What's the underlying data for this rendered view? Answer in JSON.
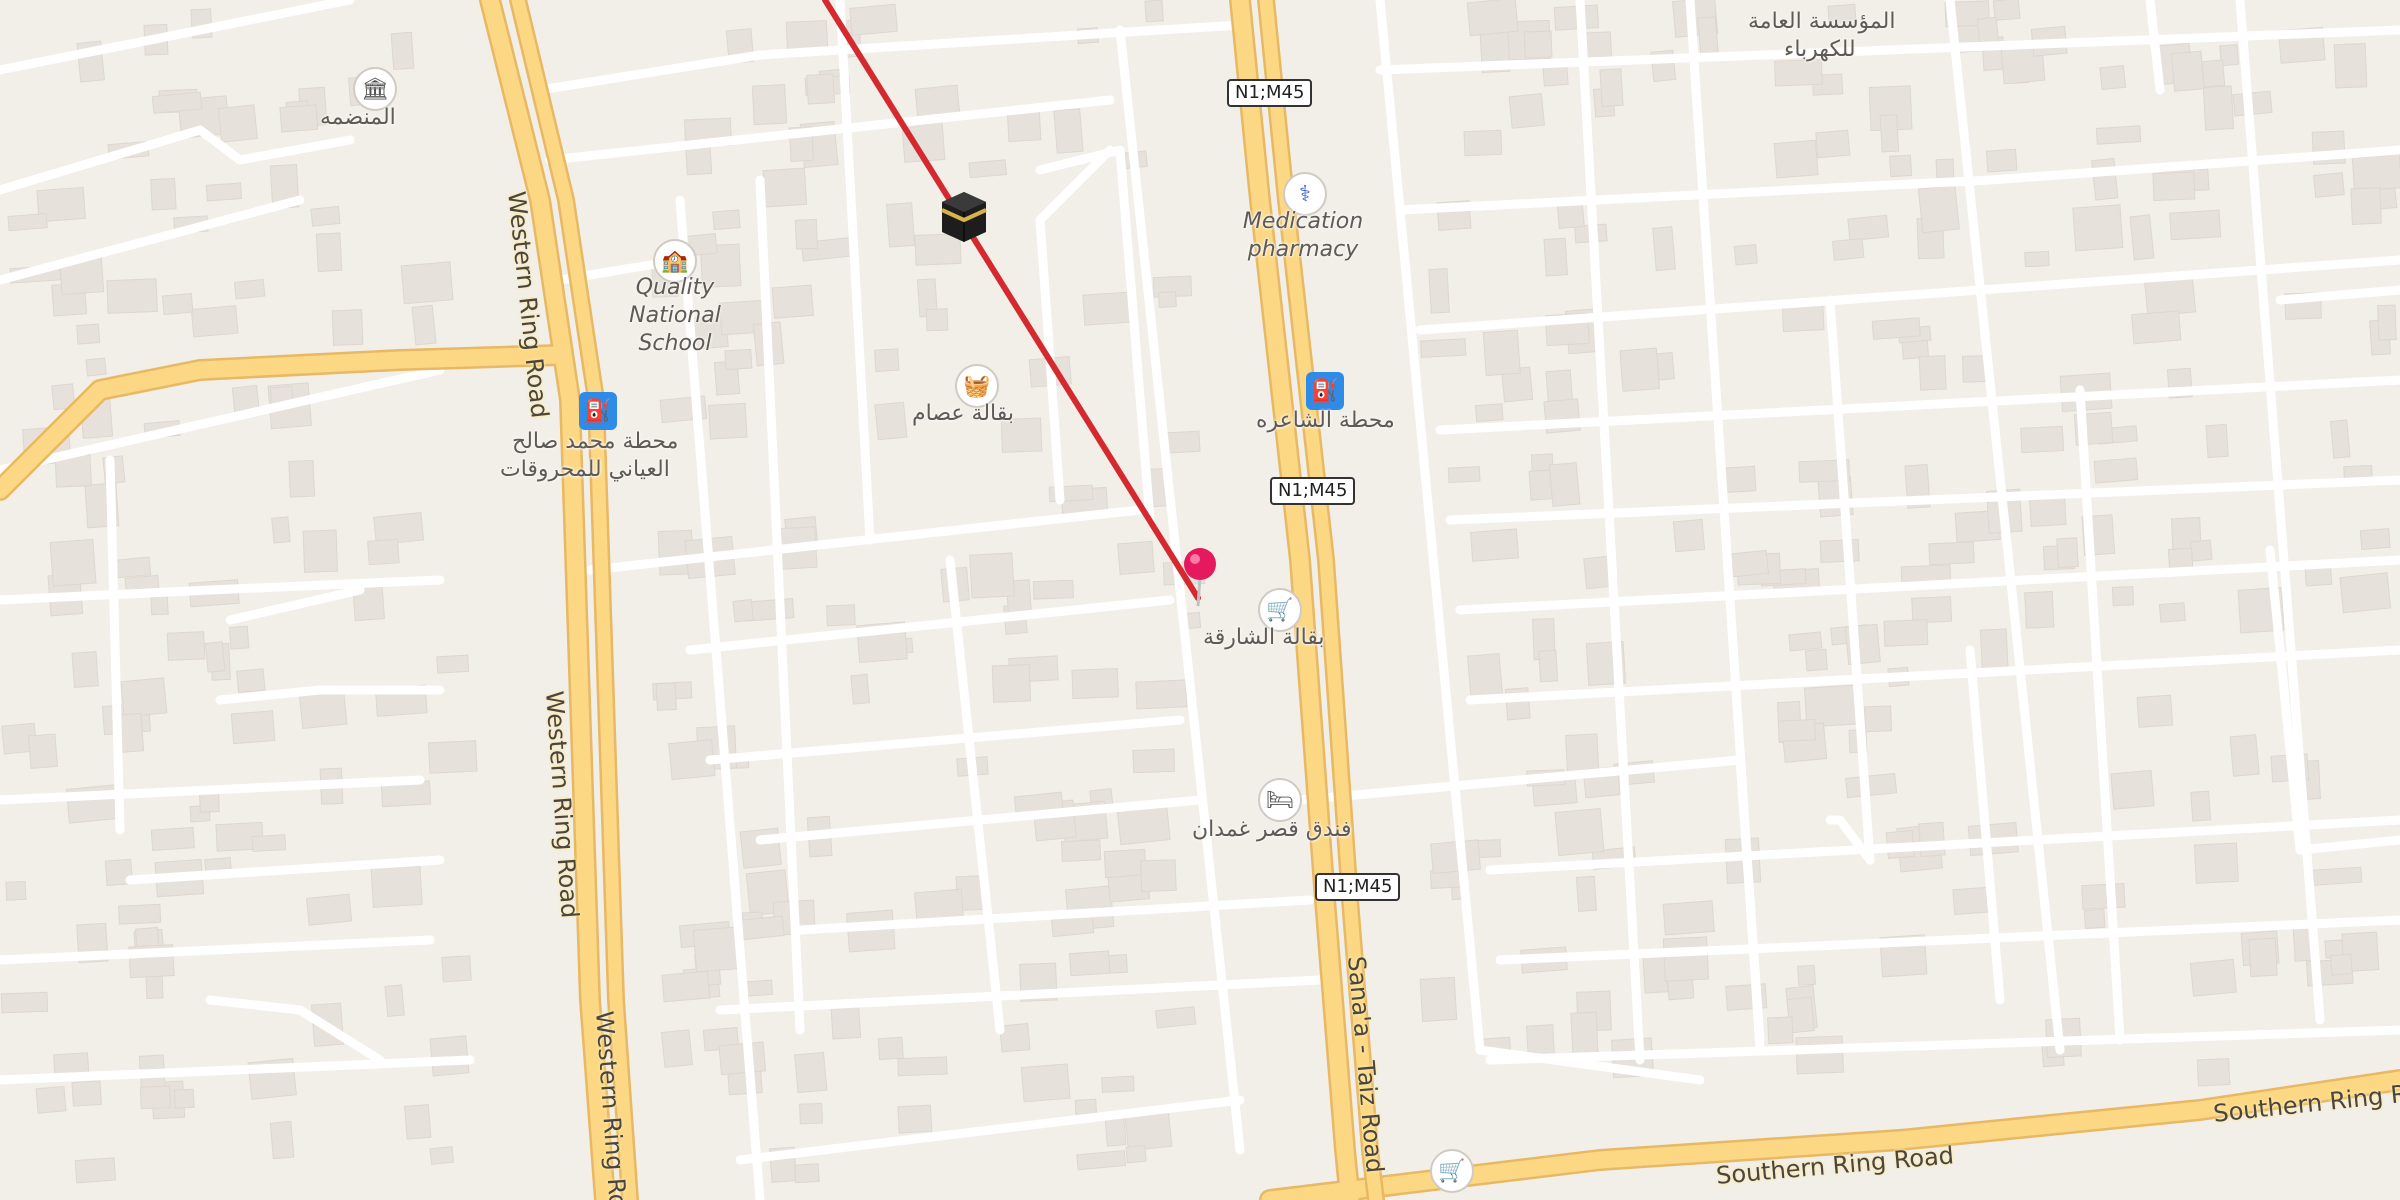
{
  "labels": {
    "monument": "المنضمه",
    "school": "Quality National School",
    "pharmacy": "Medication pharmacy",
    "grocery_asam": "بقالة عصام",
    "fuel_mohammed_line1": "محطة محمد صالح",
    "fuel_mohammed_line2": "العياني للمحروقات",
    "fuel_shaera": "محطة الشاعره",
    "grocery_sharqa": "بقالة الشارقة",
    "hotel": "فندق قصر غمدان",
    "electricity_line1": "المؤسسة العامة",
    "electricity_line2": "للكهرباء"
  },
  "shields": [
    "N1;M45",
    "N1;M45",
    "N1;M45"
  ],
  "roads": {
    "western_ring": "Western Ring Road",
    "sanaa_taiz": "Sana'a - Taiz Road",
    "southern_ring": "Southern Ring Road"
  },
  "icons": {
    "monument": "museum-icon",
    "school": "school-icon",
    "pharmacy": "pharmacy-icon",
    "grocery": "shopping-basket-icon",
    "fuel": "fuel-pump-icon",
    "cart": "shopping-cart-icon",
    "hotel": "bed-icon",
    "kaaba": "kaaba-icon",
    "pin": "location-pin-icon"
  },
  "colors": {
    "background": "#f2efe9",
    "major_road": "#fcd884",
    "major_road_casing": "#e8b864",
    "minor_road": "#ffffff",
    "building": "#e6e1da",
    "direction_line": "#d42a2f",
    "pin": "#e5195d",
    "fuel": "#2e8be8"
  }
}
